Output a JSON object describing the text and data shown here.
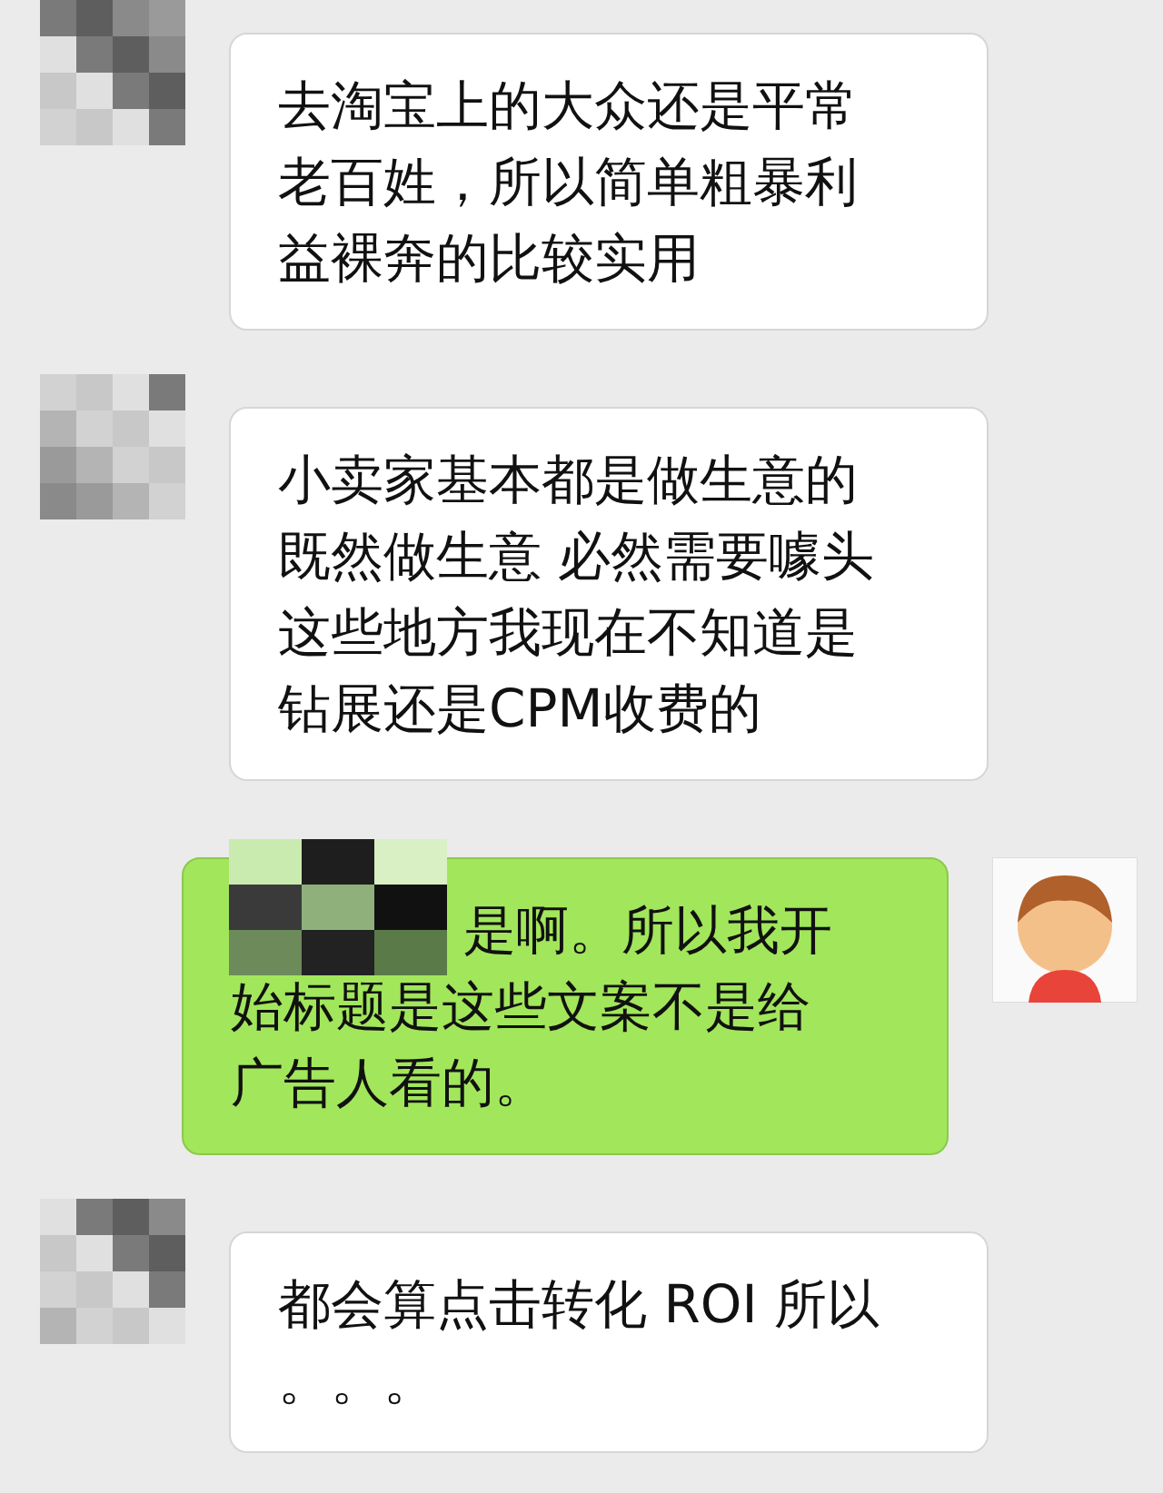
{
  "messages": [
    {
      "kind": "incoming",
      "lines": [
        "去淘宝上的大众还是平常",
        "老百姓，所以简单粗暴利",
        "益裸奔的比较实用"
      ]
    },
    {
      "kind": "incoming",
      "lines": [
        "小卖家基本都是做生意的",
        "既然做生意 必然需要噱头",
        " 这些地方我现在不知道是",
        "钻展还是CPM收费的"
      ]
    },
    {
      "kind": "outgoing",
      "lines": [
        "是啊。所以我开",
        "始标题是这些文案不是给",
        "广告人看的。"
      ]
    },
    {
      "kind": "incoming",
      "lines": [
        "都会算点击转化 ROI 所以",
        "。。。"
      ]
    }
  ]
}
